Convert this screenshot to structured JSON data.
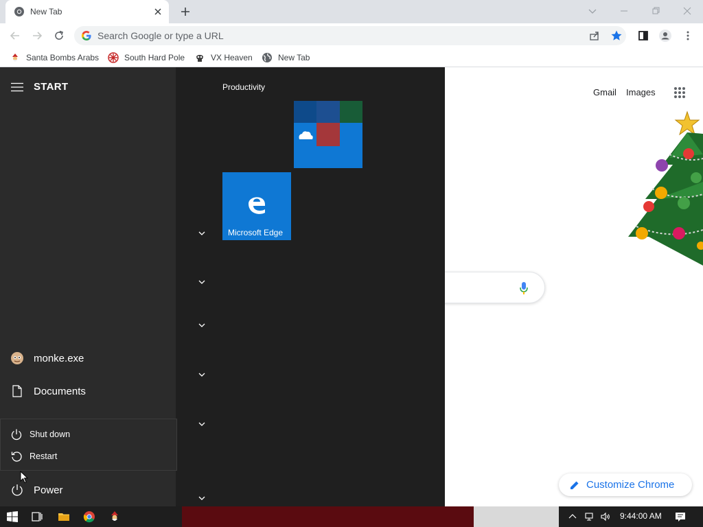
{
  "browser": {
    "tab_title": "New Tab",
    "address_placeholder": "Search Google or type a URL",
    "bookmarks": [
      {
        "label": "Santa Bombs Arabs"
      },
      {
        "label": "South Hard Pole"
      },
      {
        "label": "VX Heaven"
      },
      {
        "label": "New Tab"
      }
    ],
    "accent_color": "#1a73e8"
  },
  "ntp": {
    "gmail": "Gmail",
    "images": "Images",
    "customize": "Customize Chrome"
  },
  "start_menu": {
    "title": "START",
    "user": "monke.exe",
    "documents": "Documents",
    "power_menu": {
      "shutdown": "Shut down",
      "restart": "Restart"
    },
    "power": "Power",
    "group_title": "Productivity",
    "tiles": [
      {
        "label": ""
      },
      {
        "label": "Microsoft Edge"
      }
    ],
    "tile_color": "#0f78d4"
  },
  "taskbar": {
    "clock": "9:44:00 AM"
  }
}
